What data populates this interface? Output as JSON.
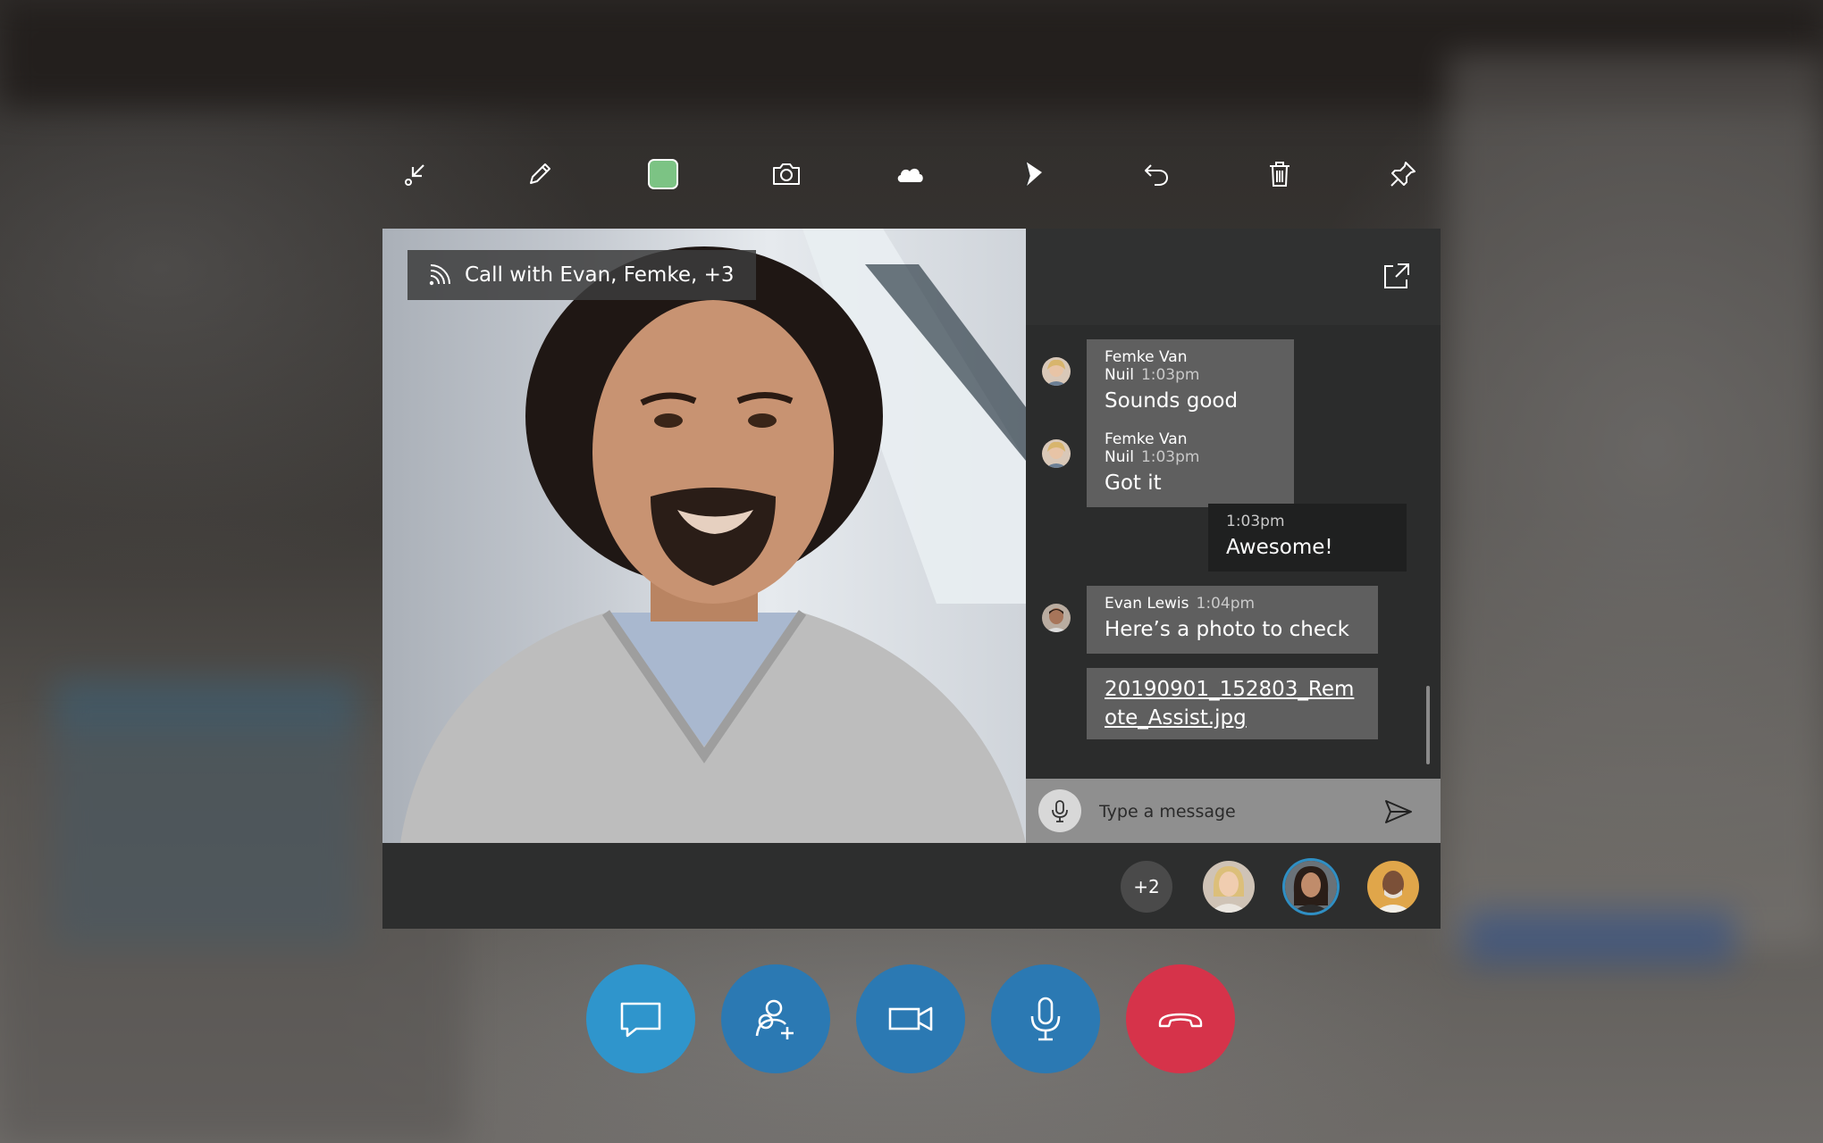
{
  "toolbar": {
    "items": [
      {
        "icon": "minimize-arrow-icon"
      },
      {
        "icon": "pen-icon"
      },
      {
        "icon": "color-swatch-icon",
        "color": "#7cc384"
      },
      {
        "icon": "camera-icon"
      },
      {
        "icon": "onedrive-cloud-icon"
      },
      {
        "icon": "dynamics-icon"
      },
      {
        "icon": "undo-icon"
      },
      {
        "icon": "delete-icon"
      },
      {
        "icon": "pin-icon"
      }
    ]
  },
  "call": {
    "title": "Call with Evan, Femke, +3",
    "icon": "signal-icon"
  },
  "chat": {
    "messages": [
      {
        "sender": "Femke Van Nuil",
        "time": "1:03pm",
        "text": "Sounds good"
      },
      {
        "sender": "Femke Van Nuil",
        "time": "1:03pm",
        "text": "Got it"
      },
      {
        "sender": "",
        "time": "1:03pm",
        "text": "Awesome!"
      },
      {
        "sender": "Evan Lewis",
        "time": "1:04pm",
        "text": "Here’s a photo to check"
      }
    ],
    "attachment": "20190901_152803_Remote_Assist.jpg",
    "input_placeholder": "Type a message"
  },
  "participants": {
    "more_count": "+2"
  },
  "controls": {
    "colors": {
      "chat": "#2f95cc",
      "blue": "#2b79b3",
      "hangup": "#d6334a"
    }
  }
}
